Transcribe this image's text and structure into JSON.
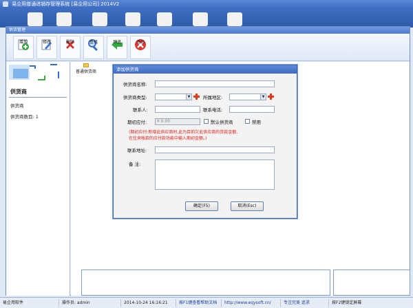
{
  "app": {
    "window_title": "易企用普通进销存管理系统 [易企用公司] 2014V2"
  },
  "child_window": {
    "title": "供货管理",
    "toolbar": [
      {
        "label": "增加",
        "icon": "add-icon"
      },
      {
        "label": "修改",
        "icon": "edit-icon"
      },
      {
        "label": "删除",
        "icon": "delete-icon"
      },
      {
        "label": "查找",
        "icon": "search-icon"
      },
      {
        "label": "后退",
        "icon": "back-icon"
      },
      {
        "label": "退出",
        "icon": "exit-icon"
      }
    ],
    "left_pane": {
      "title": "供货商",
      "item": "供货商",
      "count_label": "供货商数目: 1"
    },
    "grid": {
      "folder_label": "普通供货商"
    }
  },
  "dialog": {
    "title": "添加供货商",
    "fields": {
      "name_label": "供货商名称:",
      "type_label": "供货商类型:",
      "region_label": "所属地区:",
      "contact_label": "联系人:",
      "phone_label": "联系电话:",
      "payable_label": "期初应付:",
      "payable_value": "¥ 0.00",
      "default_label": "默认供货商",
      "disable_label": "禁用",
      "address_label": "联系地址:",
      "remark_label": "备    注:"
    },
    "note_line1": "(期初应付:新增此供应商时,此为目前欠此供应商的货款金额,",
    "note_line2": "在往来帐款的应付款功能中输入期初金额。)",
    "ok_button": "确定(F5)",
    "cancel_button": "取消(Esc)"
  },
  "statusbar": {
    "app_name": "易企用软件",
    "operator": "操作员: admin",
    "datetime": "2014-10-24 16:16:21",
    "help": "按F1键查看帮助文档",
    "url": "http://www.eqysoft.cn/",
    "slogan": "专注完美 追求",
    "lock_hint": "按F2键锁定屏幕"
  },
  "colors": {
    "titlebar": "#4a78c8",
    "accent_red": "#e3201b",
    "plus_red": "#e53a17"
  }
}
